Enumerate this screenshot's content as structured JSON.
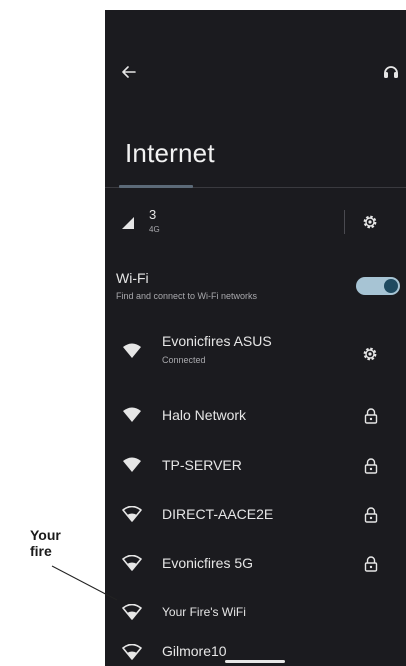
{
  "header": {
    "title": "Internet"
  },
  "mobile": {
    "name": "3",
    "type": "4G"
  },
  "wifi": {
    "label": "Wi-Fi",
    "description": "Find and connect to Wi-Fi networks",
    "enabled": true
  },
  "networks": [
    {
      "name": "Evonicfires ASUS",
      "status": "Connected",
      "secured": false,
      "icon": "wifi-filled-icon"
    },
    {
      "name": "Halo Network",
      "secured": true,
      "icon": "wifi-filled-icon"
    },
    {
      "name": "TP-SERVER",
      "secured": true,
      "icon": "wifi-filled-icon"
    },
    {
      "name": "DIRECT-AACE2E",
      "secured": true,
      "icon": "wifi-outline-icon"
    },
    {
      "name": "Evonicfires 5G",
      "secured": true,
      "icon": "wifi-outline-icon"
    },
    {
      "name": "Your Fire's WiFi",
      "secured": false,
      "icon": "wifi-outline-icon"
    },
    {
      "name": "Gilmore10",
      "secured": false,
      "icon": "wifi-outline-icon"
    }
  ],
  "annotation": {
    "line1": "Your",
    "line2": "fire"
  },
  "colors": {
    "background": "#1b1b1f",
    "toggle_track": "#a7c4d4",
    "toggle_knob": "#1f4a60"
  }
}
